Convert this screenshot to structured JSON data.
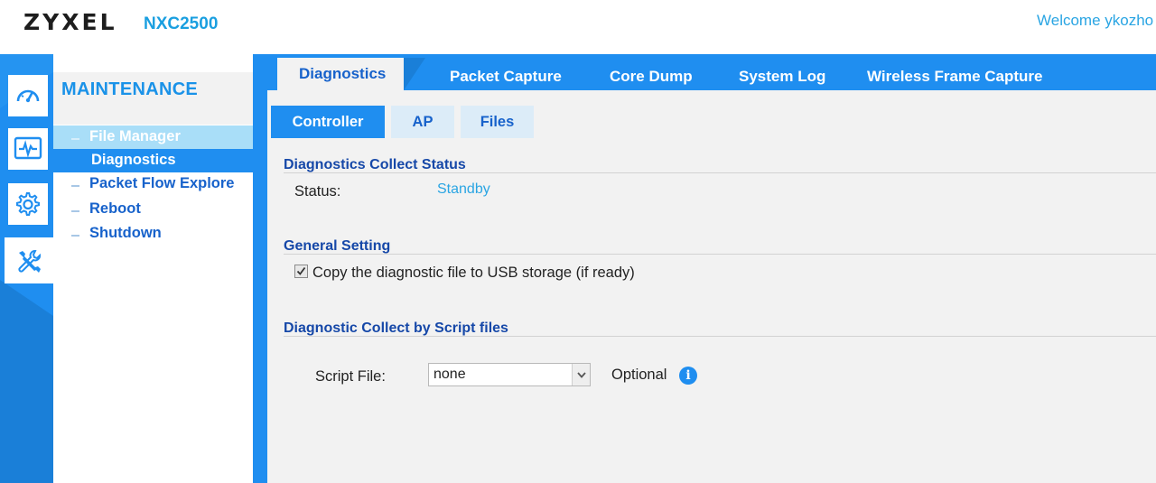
{
  "header": {
    "brand": "ZYXEL",
    "model": "NXC2500",
    "welcome": "Welcome ykozho"
  },
  "rail": {
    "icons": [
      "dashboard-icon",
      "monitor-icon",
      "gear-icon",
      "tools-icon"
    ],
    "active": "tools-icon"
  },
  "sidebar": {
    "title": "MAINTENANCE",
    "items": [
      {
        "label": "File Manager"
      },
      {
        "label": "Diagnostics"
      },
      {
        "label": "Packet Flow Explore"
      },
      {
        "label": "Reboot"
      },
      {
        "label": "Shutdown"
      }
    ]
  },
  "tabs": [
    {
      "label": "Diagnostics"
    },
    {
      "label": "Packet Capture"
    },
    {
      "label": "Core Dump"
    },
    {
      "label": "System Log"
    },
    {
      "label": "Wireless Frame Capture"
    }
  ],
  "subtabs": [
    {
      "label": "Controller"
    },
    {
      "label": "AP"
    },
    {
      "label": "Files"
    }
  ],
  "collect_status": {
    "title": "Diagnostics Collect Status",
    "status_label": "Status:",
    "status_value": "Standby"
  },
  "general": {
    "title": "General Setting",
    "copy_label": "Copy the diagnostic file to USB storage (if ready)",
    "copy_checked": true
  },
  "script": {
    "title": "Diagnostic Collect by Script files",
    "file_label": "Script File:",
    "file_value": "none",
    "optional_label": "Optional"
  },
  "colors": {
    "accent": "#1f8ef0",
    "brand_blue": "#1a9fe0",
    "title_blue": "#1648a8",
    "status_blue": "#2aa5e3"
  }
}
